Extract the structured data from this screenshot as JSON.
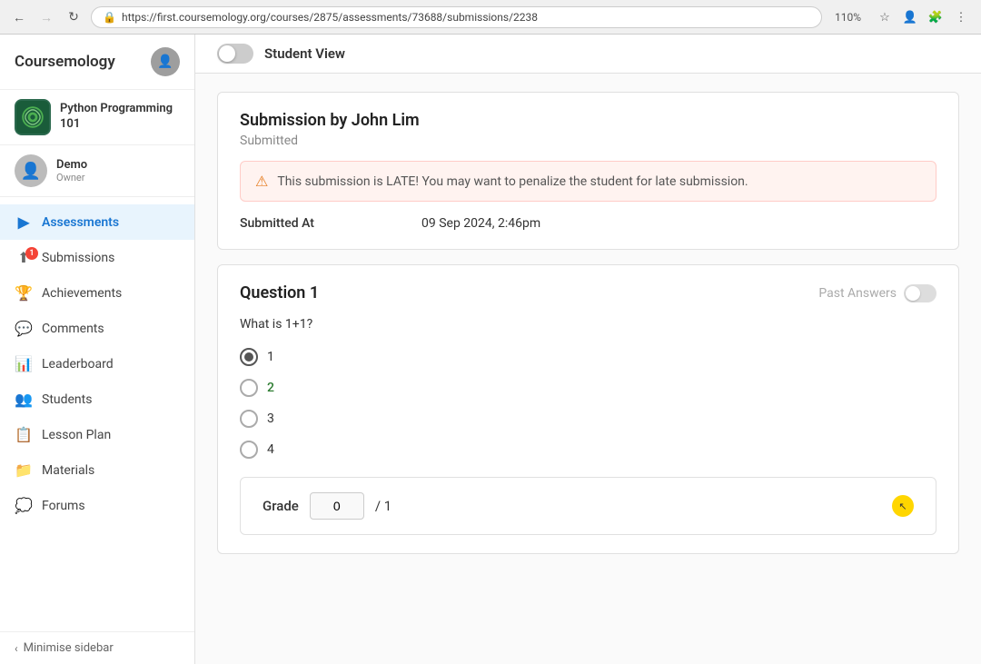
{
  "browser": {
    "url": "https://first.coursemology.org/courses/2875/assessments/73688/submissions/2238",
    "zoom": "110%",
    "back_disabled": false,
    "forward_disabled": true
  },
  "sidebar": {
    "logo": "Coursemology",
    "course": {
      "title": "Python Programming 101"
    },
    "user": {
      "name": "Demo",
      "role": "Owner"
    },
    "nav_items": [
      {
        "id": "assessments",
        "label": "Assessments",
        "active": true,
        "badge": null,
        "icon": "▶"
      },
      {
        "id": "submissions",
        "label": "Submissions",
        "active": false,
        "badge": "1",
        "icon": "⬆"
      },
      {
        "id": "achievements",
        "label": "Achievements",
        "active": false,
        "badge": null,
        "icon": "🏆"
      },
      {
        "id": "comments",
        "label": "Comments",
        "active": false,
        "badge": null,
        "icon": "💬"
      },
      {
        "id": "leaderboard",
        "label": "Leaderboard",
        "active": false,
        "badge": null,
        "icon": "📊"
      },
      {
        "id": "students",
        "label": "Students",
        "active": false,
        "badge": null,
        "icon": "👥"
      },
      {
        "id": "lesson-plan",
        "label": "Lesson Plan",
        "active": false,
        "badge": null,
        "icon": "📋"
      },
      {
        "id": "materials",
        "label": "Materials",
        "active": false,
        "badge": null,
        "icon": "📁"
      },
      {
        "id": "forums",
        "label": "Forums",
        "active": false,
        "badge": null,
        "icon": "💭"
      }
    ],
    "minimise_label": "Minimise sidebar"
  },
  "student_view": {
    "label": "Student View",
    "enabled": false
  },
  "submission": {
    "title": "Submission by John Lim",
    "status": "Submitted",
    "late_warning": "This submission is LATE! You may want to penalize the student for late submission.",
    "submitted_at_label": "Submitted At",
    "submitted_at_value": "09 Sep 2024, 2:46pm"
  },
  "question": {
    "title": "Question 1",
    "past_answers_label": "Past Answers",
    "text": "What is 1+1?",
    "options": [
      {
        "value": "1",
        "selected": true,
        "highlighted": false
      },
      {
        "value": "2",
        "selected": false,
        "highlighted": true
      },
      {
        "value": "3",
        "selected": false,
        "highlighted": false
      },
      {
        "value": "4",
        "selected": false,
        "highlighted": false
      }
    ]
  },
  "grade": {
    "label": "Grade",
    "value": "0",
    "total": "1"
  }
}
